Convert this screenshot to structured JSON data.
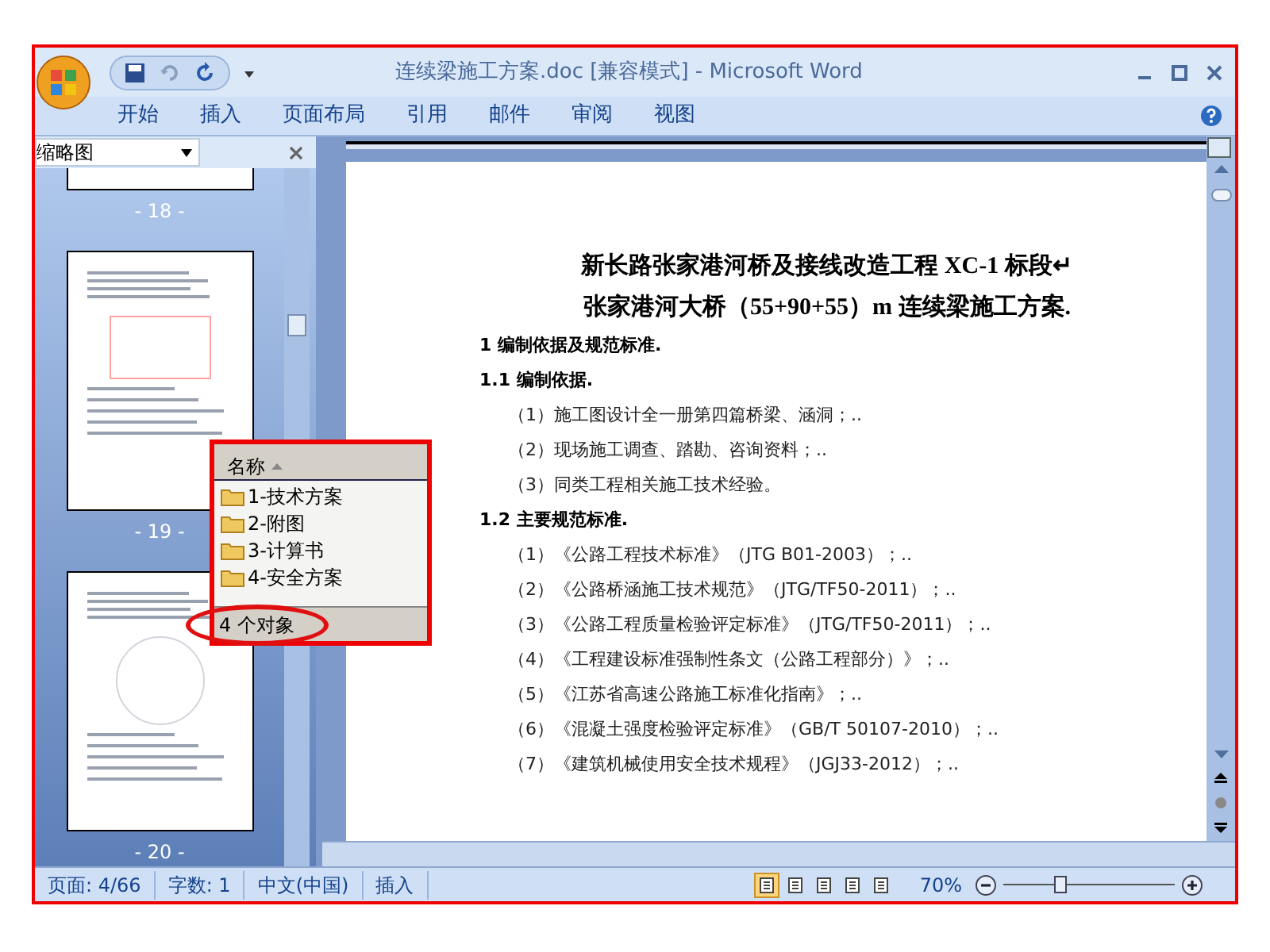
{
  "window": {
    "title": "连续梁施工方案.doc [兼容模式] - Microsoft Word"
  },
  "ribbon_tabs": [
    "开始",
    "插入",
    "页面布局",
    "引用",
    "邮件",
    "审阅",
    "视图"
  ],
  "thumbnail_pane": {
    "title": "缩略图",
    "page_labels": [
      "- 18 -",
      "- 19 -",
      "- 20 -"
    ]
  },
  "document": [
    {
      "kind": "title",
      "text": "新长路张家港河桥及接线改造工程 XC-1 标段↵"
    },
    {
      "kind": "title",
      "text": "张家港河大桥（55+90+55）m 连续梁施工方案."
    },
    {
      "kind": "heading",
      "text": "1  编制依据及规范标准."
    },
    {
      "kind": "heading",
      "text": "1.1  编制依据."
    },
    {
      "kind": "item",
      "text": "（1）施工图设计全一册第四篇桥梁、涵洞；.."
    },
    {
      "kind": "item",
      "text": "（2）现场施工调查、踏勘、咨询资料；.."
    },
    {
      "kind": "item",
      "text": "（3）同类工程相关施工技术经验。"
    },
    {
      "kind": "heading",
      "text": "1.2  主要规范标准."
    },
    {
      "kind": "item",
      "text": "（1）《公路工程技术标准》（JTG B01-2003）；.."
    },
    {
      "kind": "item",
      "text": "（2）《公路桥涵施工技术规范》（JTG/TF50-2011）；.."
    },
    {
      "kind": "item",
      "text": "（3）《公路工程质量检验评定标准》（JTG/TF50-2011）；.."
    },
    {
      "kind": "item",
      "text": "（4）《工程建设标准强制性条文（公路工程部分）》；.."
    },
    {
      "kind": "item",
      "text": "（5）《江苏省高速公路施工标准化指南》；.."
    },
    {
      "kind": "item",
      "text": "（6）《混凝土强度检验评定标准》（GB/T 50107-2010）；.."
    },
    {
      "kind": "item",
      "text": "（7）《建筑机械使用安全技术规程》（JGJ33-2012）；.."
    }
  ],
  "explorer_inset": {
    "column": "名称",
    "folders": [
      "1-技术方案",
      "2-附图",
      "3-计算书",
      "4-安全方案"
    ],
    "status": "4 个对象"
  },
  "status_bar": {
    "items": [
      "页面: 4/66",
      "字数: 1",
      "中文(中国)",
      "插入"
    ],
    "views": [
      {
        "selected": true
      },
      {
        "selected": false
      },
      {
        "selected": false
      },
      {
        "selected": false
      },
      {
        "selected": false
      }
    ],
    "zoom": "70%",
    "zoom_slider": {
      "level": 0.33
    }
  }
}
